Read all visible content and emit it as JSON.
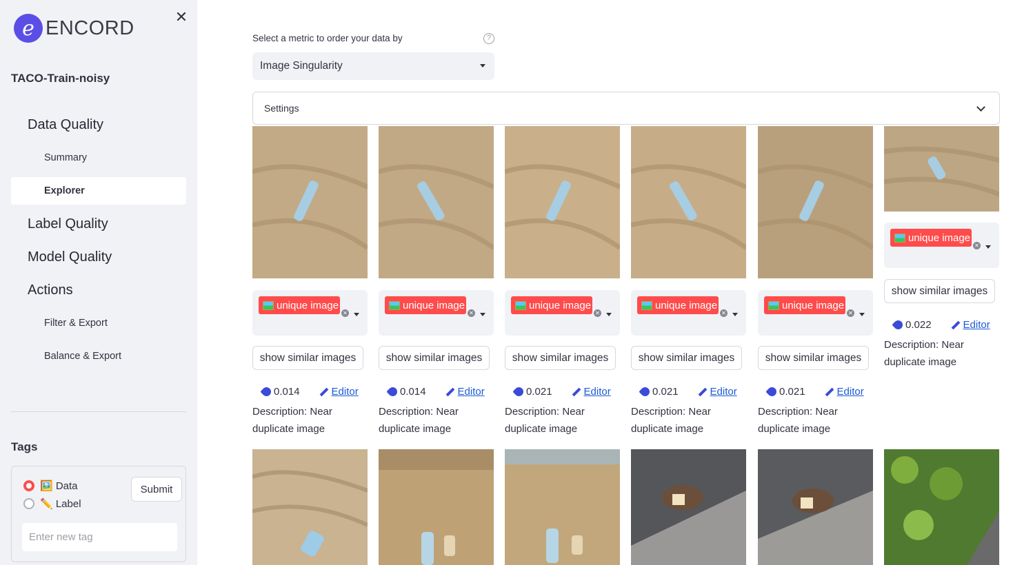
{
  "app": {
    "logo_text": "ENCORD",
    "project": "TACO-Train-noisy"
  },
  "sidebar": {
    "nav": [
      {
        "label": "Data Quality",
        "level": 1
      },
      {
        "label": "Summary",
        "level": 2
      },
      {
        "label": "Explorer",
        "level": 2,
        "active": true
      },
      {
        "label": "Label Quality",
        "level": 1
      },
      {
        "label": "Model Quality",
        "level": 1
      },
      {
        "label": "Actions",
        "level": 1
      },
      {
        "label": "Filter & Export",
        "level": 2
      },
      {
        "label": "Balance & Export",
        "level": 2
      }
    ],
    "tags": {
      "title": "Tags",
      "options": [
        {
          "label": "🖼️ Data",
          "selected": true
        },
        {
          "label": "✏️ Label",
          "selected": false
        }
      ],
      "submit_label": "Submit",
      "input_placeholder": "Enter new tag"
    }
  },
  "main": {
    "metric_label": "Select a metric to order your data by",
    "metric_selected": "Image Singularity",
    "settings_label": "Settings",
    "cards": [
      {
        "tag": "unique image",
        "button": "show similar images",
        "score": "0.014",
        "editor": "Editor",
        "description": "Description: Near duplicate image"
      },
      {
        "tag": "unique image",
        "button": "show similar images",
        "score": "0.014",
        "editor": "Editor",
        "description": "Description: Near duplicate image"
      },
      {
        "tag": "unique image",
        "button": "show similar images",
        "score": "0.021",
        "editor": "Editor",
        "description": "Description: Near duplicate image"
      },
      {
        "tag": "unique image",
        "button": "show similar images",
        "score": "0.021",
        "editor": "Editor",
        "description": "Description: Near duplicate image"
      },
      {
        "tag": "unique image",
        "button": "show similar images",
        "score": "0.021",
        "editor": "Editor",
        "description": "Description: Near duplicate image"
      },
      {
        "tag": "unique image",
        "button": "show similar images",
        "score": "0.022",
        "editor": "Editor",
        "description": "Description: Near duplicate image"
      }
    ]
  },
  "colors": {
    "accent": "#ff4b4b",
    "sidebar_bg": "#f0f2f6",
    "link": "#1a5ad6",
    "logo": "#5b4ee6"
  }
}
